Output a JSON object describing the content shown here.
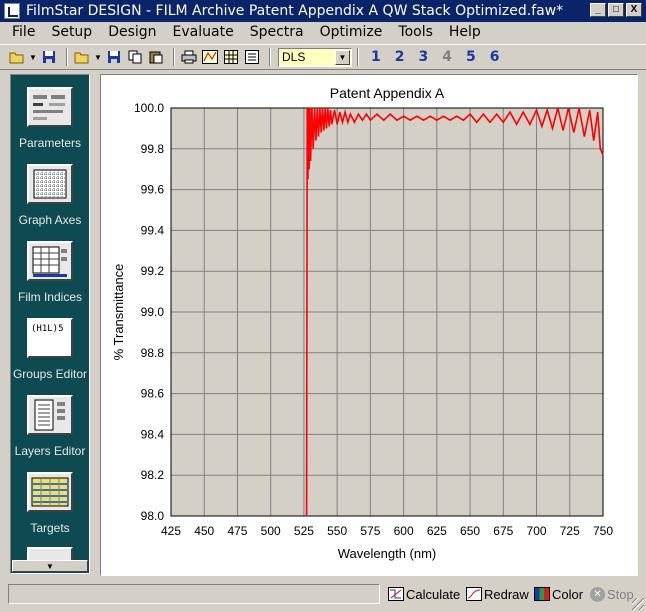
{
  "window": {
    "title": "FilmStar DESIGN - FILM Archive Patent Appendix A QW Stack Optimized.faw*",
    "controls": [
      "_",
      "□",
      "X"
    ]
  },
  "menu": [
    {
      "label": "File",
      "underline": "F"
    },
    {
      "label": "Setup",
      "underline": "S"
    },
    {
      "label": "Design",
      "underline": "D"
    },
    {
      "label": "Evaluate",
      "underline": "v"
    },
    {
      "label": "Spectra",
      "underline": "p"
    },
    {
      "label": "Optimize",
      "underline": "O"
    },
    {
      "label": "Tools",
      "underline": "T"
    },
    {
      "label": "Help",
      "underline": "H"
    }
  ],
  "toolbar": {
    "combo_value": "DLS",
    "numbers": [
      "1",
      "2",
      "3",
      "4",
      "5",
      "6"
    ]
  },
  "sidebar": {
    "items": [
      {
        "label": "Parameters",
        "icon": "parameters-icon"
      },
      {
        "label": "Graph Axes",
        "icon": "graph-axes-icon"
      },
      {
        "label": "Film Indices",
        "icon": "film-indices-icon"
      },
      {
        "label": "Groups Editor",
        "icon": "groups-editor-icon",
        "icon_text": "(H1L)5"
      },
      {
        "label": "Layers Editor",
        "icon": "layers-editor-icon"
      },
      {
        "label": "Targets",
        "icon": "targets-icon"
      }
    ]
  },
  "chart_data": {
    "type": "line",
    "title": "Patent Appendix A",
    "xlabel": "Wavelength (nm)",
    "ylabel": "% Transmittance",
    "xlim": [
      425,
      750
    ],
    "ylim": [
      98.0,
      100.0
    ],
    "x_ticks": [
      425,
      450,
      475,
      500,
      525,
      550,
      575,
      600,
      625,
      650,
      675,
      700,
      725,
      750
    ],
    "y_ticks": [
      "98.0",
      "98.2",
      "98.4",
      "98.6",
      "98.8",
      "99.0",
      "99.2",
      "99.4",
      "99.6",
      "99.8",
      "100.0"
    ],
    "grid": true,
    "background": "#d4d0c8",
    "line_color": "#ff0000",
    "series": [
      {
        "x": [
          527,
          527.5,
          528,
          528.5,
          529,
          529.5,
          530,
          531,
          532,
          533,
          534,
          535,
          536,
          537,
          538,
          539,
          540,
          541,
          542,
          543,
          544,
          545,
          546,
          548,
          550,
          552,
          554,
          556,
          558,
          560,
          563,
          566,
          569,
          572,
          575,
          580,
          585,
          590,
          595,
          600,
          605,
          610,
          615,
          620,
          625,
          630,
          635,
          640,
          645,
          650,
          655,
          660,
          665,
          670,
          675,
          680,
          685,
          690,
          695,
          700,
          704,
          708,
          712,
          716,
          720,
          724,
          728,
          732,
          736,
          740,
          743,
          746,
          748,
          750
        ],
        "y": [
          98.0,
          100.0,
          99.65,
          100.0,
          99.7,
          100.0,
          99.74,
          100.0,
          99.8,
          100.0,
          99.84,
          100.0,
          99.86,
          100.0,
          99.88,
          100.0,
          99.89,
          100.0,
          99.9,
          100.0,
          99.91,
          99.99,
          99.92,
          99.99,
          99.92,
          99.98,
          99.93,
          99.98,
          99.93,
          99.97,
          99.93,
          99.97,
          99.94,
          99.97,
          99.94,
          99.97,
          99.94,
          99.97,
          99.94,
          99.96,
          99.94,
          99.96,
          99.94,
          99.96,
          99.94,
          99.96,
          99.94,
          99.96,
          99.94,
          99.97,
          99.93,
          99.97,
          99.93,
          99.97,
          99.93,
          99.98,
          99.92,
          99.98,
          99.92,
          99.99,
          99.91,
          99.99,
          99.9,
          100.0,
          99.89,
          100.0,
          99.88,
          100.0,
          99.86,
          99.99,
          99.84,
          99.98,
          99.8,
          99.77
        ]
      }
    ]
  },
  "status": {
    "buttons": [
      {
        "label": "Calculate",
        "enabled": true
      },
      {
        "label": "Redraw",
        "enabled": true
      },
      {
        "label": "Color",
        "enabled": true
      },
      {
        "label": "Stop",
        "enabled": false
      }
    ]
  }
}
